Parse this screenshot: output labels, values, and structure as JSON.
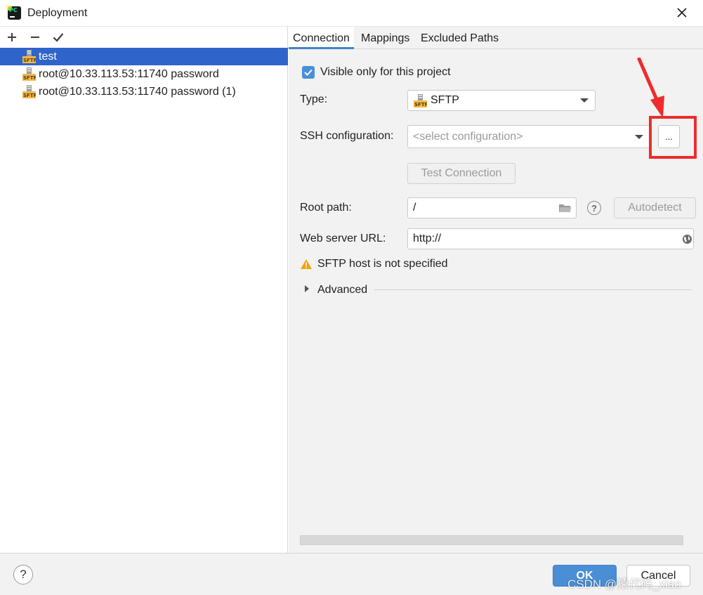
{
  "window": {
    "title": "Deployment",
    "close_icon": "close-icon",
    "app_icon_text": "PC"
  },
  "left": {
    "toolbar": {
      "add_icon": "plus-icon",
      "remove_icon": "minus-icon",
      "default_icon": "check-icon"
    },
    "servers": [
      {
        "label": "test",
        "icon": "sftp-server-icon",
        "selected": true
      },
      {
        "label": "root@10.33.113.53:11740 password",
        "icon": "sftp-server-icon",
        "selected": false
      },
      {
        "label": "root@10.33.113.53:11740 password (1)",
        "icon": "sftp-server-icon",
        "selected": false
      }
    ]
  },
  "tabs": [
    {
      "label": "Connection",
      "active": true
    },
    {
      "label": "Mappings",
      "active": false
    },
    {
      "label": "Excluded Paths",
      "active": false
    }
  ],
  "connection": {
    "visible_only_label": "Visible only for this project",
    "visible_only_checked": true,
    "type_label": "Type:",
    "type_value": "SFTP",
    "ssh_label": "SSH configuration:",
    "ssh_placeholder": "<select configuration>",
    "ssh_browse_label": "...",
    "test_connection_label": "Test Connection",
    "root_path_label": "Root path:",
    "root_path_value": "/",
    "autodetect_label": "Autodetect",
    "web_url_label": "Web server URL:",
    "web_url_value": "http://",
    "warning_text": "SFTP host is not specified",
    "advanced_label": "Advanced"
  },
  "footer": {
    "help_label": "?",
    "ok_label": "OK",
    "cancel_label": "Cancel",
    "watermark": "CSDN @猿代码_xiao"
  },
  "colors": {
    "accent": "#4a8ed6",
    "selection": "#2f65ca",
    "highlight_annotation": "#ee2c2c",
    "warning": "#f0a30a"
  }
}
